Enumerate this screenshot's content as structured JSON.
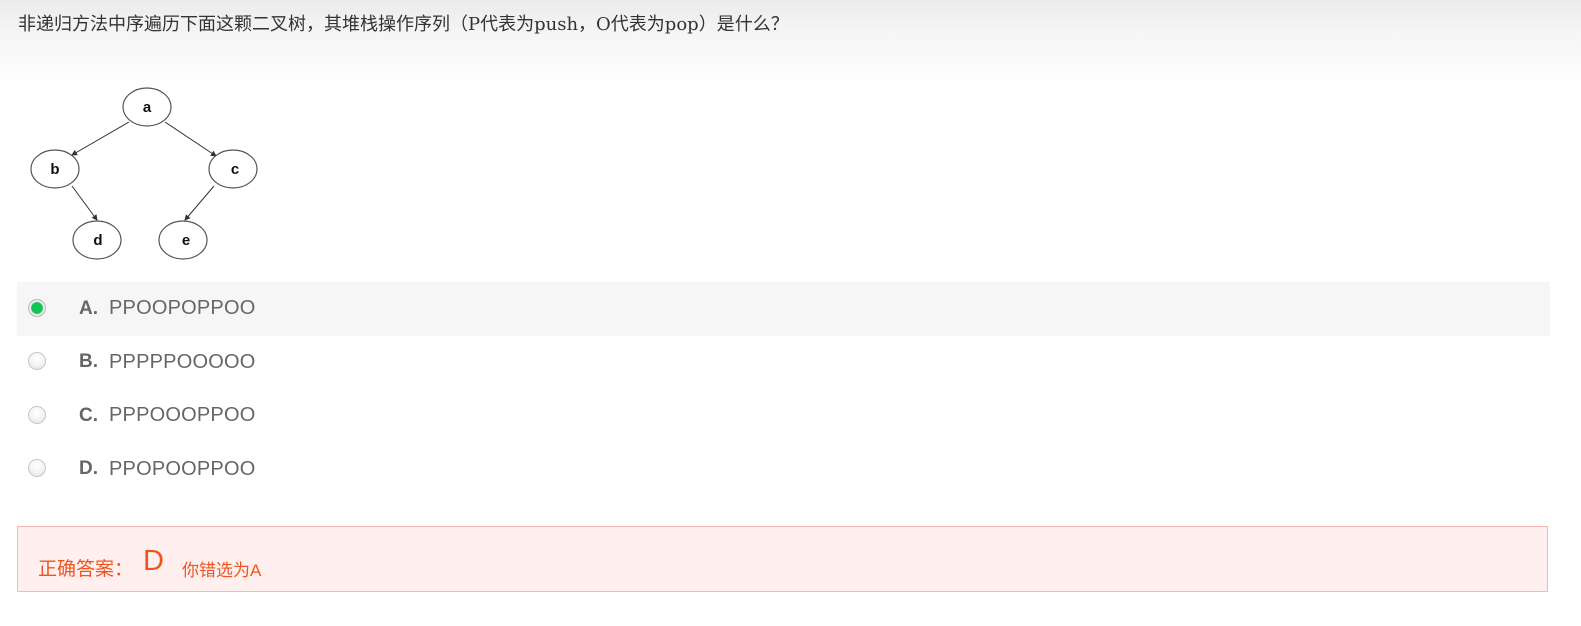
{
  "question": {
    "text": "非递归方法中序遍历下面这颗二叉树，其堆栈操作序列（P代表为push，O代表为pop）是什么？"
  },
  "tree": {
    "nodes": [
      "a",
      "b",
      "c",
      "d",
      "e"
    ]
  },
  "options": [
    {
      "letter": "A.",
      "text": "PPOOPOPPOO",
      "selected": true
    },
    {
      "letter": "B.",
      "text": "PPPPPOOOOO",
      "selected": false
    },
    {
      "letter": "C.",
      "text": "PPPOOOPPOO",
      "selected": false
    },
    {
      "letter": "D.",
      "text": "PPOPOOPPOO",
      "selected": false
    }
  ],
  "answer": {
    "label": "正确答案：",
    "value": "D",
    "note": "你错选为A"
  },
  "colors": {
    "accent_error": "#f0541e",
    "radio_checked": "#15c353",
    "answer_bg": "#fff0ef",
    "answer_border": "#f4b9b3"
  }
}
